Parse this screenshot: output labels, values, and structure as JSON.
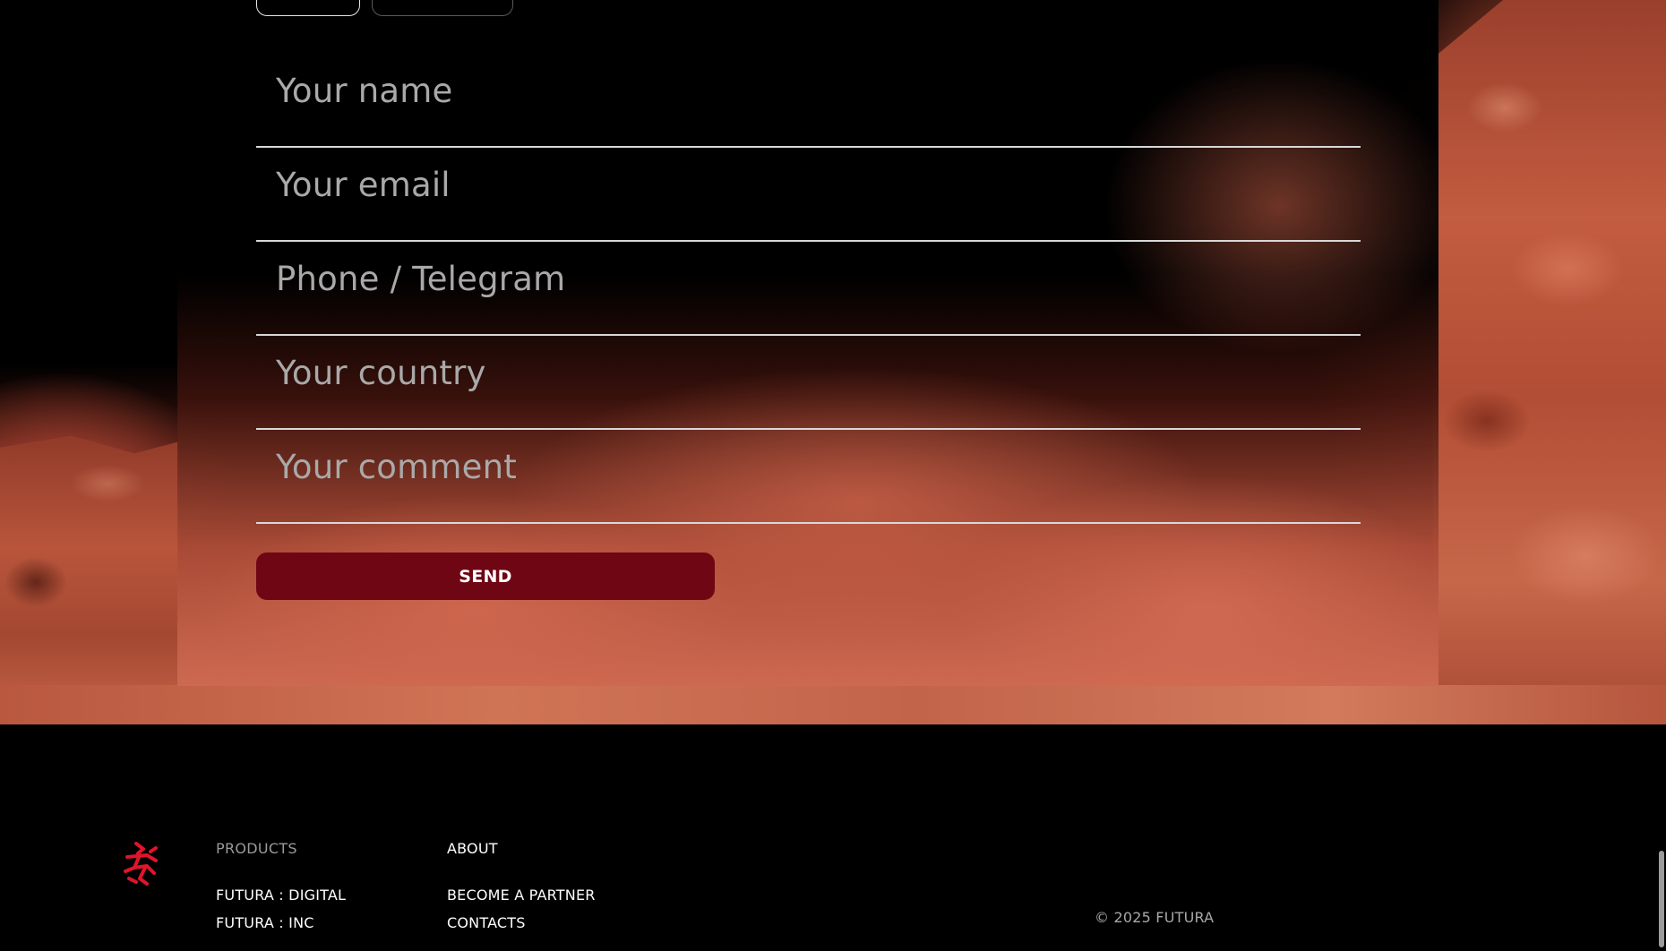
{
  "form": {
    "name_placeholder": "Your name",
    "email_placeholder": "Your email",
    "phone_placeholder": "Phone / Telegram",
    "country_placeholder": "Your country",
    "comment_placeholder": "Your comment",
    "send_label": "SEND"
  },
  "footer": {
    "logo_icon": "futura-logo-icon",
    "products": {
      "heading": "PRODUCTS",
      "links": [
        "FUTURA : DIGITAL",
        "FUTURA : INC"
      ]
    },
    "about": {
      "heading": "ABOUT",
      "links": [
        "BECOME A PARTNER",
        "CONTACTS"
      ]
    },
    "copyright": "©  2025 FUTURA"
  },
  "colors": {
    "accent": "#6e0613",
    "logo": "#e0142a",
    "background": "#000000",
    "terrain": "#c0583e"
  }
}
